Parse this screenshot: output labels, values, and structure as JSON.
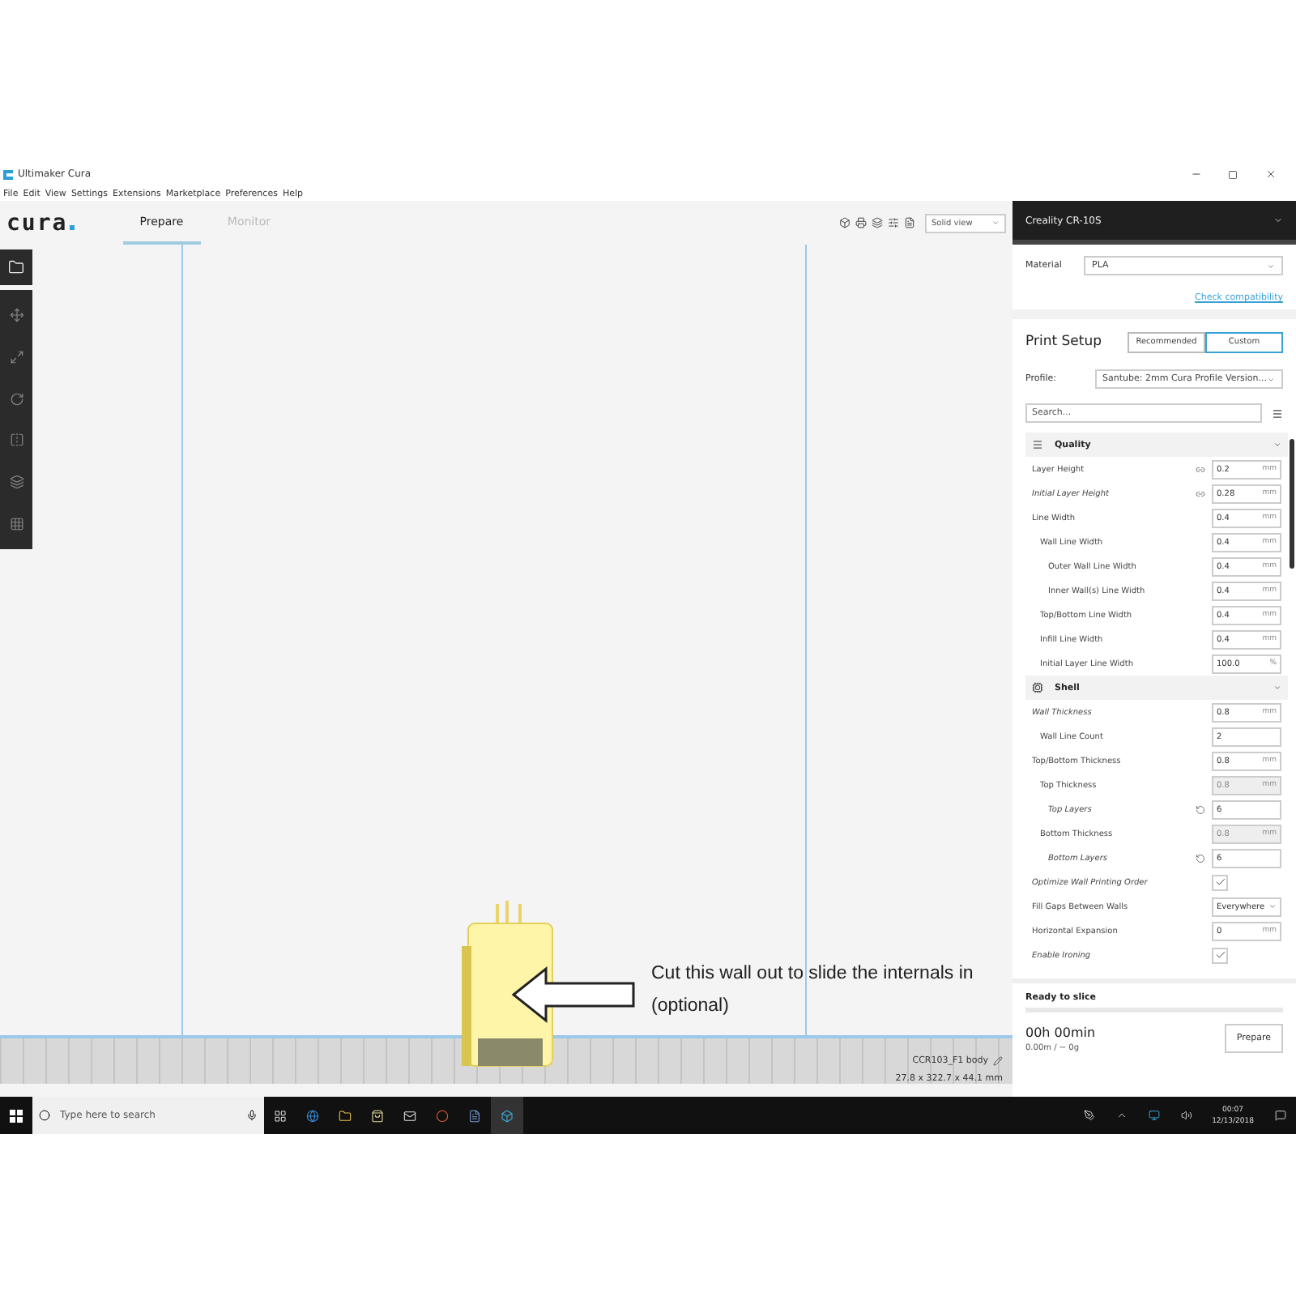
{
  "window": {
    "title": "Ultimaker Cura"
  },
  "menu": [
    "File",
    "Edit",
    "View",
    "Settings",
    "Extensions",
    "Marketplace",
    "Preferences",
    "Help"
  ],
  "header": {
    "logo": "cura",
    "tabs": [
      {
        "label": "Prepare",
        "selected": true
      },
      {
        "label": "Monitor",
        "selected": false
      }
    ],
    "view_mode": "Solid view"
  },
  "viewport": {
    "object_name": "CCR103_F1 body",
    "dimensions": "27.8 x 322.7 x 44.1 mm",
    "annotation": "Cut this wall out to slide the internals in (optional)"
  },
  "printer": {
    "name": "Creality CR-10S"
  },
  "material": {
    "label": "Material",
    "value": "PLA",
    "link": "Check compatibility"
  },
  "print_setup": {
    "title": "Print Setup",
    "modes": [
      {
        "label": "Recommended",
        "selected": false
      },
      {
        "label": "Custom",
        "selected": true
      }
    ],
    "profile_label": "Profile:",
    "profile": "Santube: 2mm Cura Profile Version...",
    "search_placeholder": "Search..."
  },
  "categories": [
    {
      "name": "Quality",
      "kind": "quality",
      "expanded": true,
      "settings": [
        {
          "label": "Layer Height",
          "kind": "number",
          "value": "0.2",
          "unit": "mm",
          "linked": true,
          "overridden": false,
          "modified": false,
          "disabled": false
        },
        {
          "label": "Initial Layer Height",
          "kind": "number",
          "value": "0.28",
          "unit": "mm",
          "linked": true,
          "overridden": false,
          "modified": true,
          "disabled": false
        },
        {
          "label": "Line Width",
          "kind": "number",
          "value": "0.4",
          "unit": "mm",
          "linked": false,
          "overridden": false,
          "modified": false,
          "disabled": false,
          "children": [
            {
              "label": "Wall Line Width",
              "kind": "number",
              "value": "0.4",
              "unit": "mm",
              "linked": false,
              "overridden": false,
              "modified": false,
              "disabled": false,
              "children": [
                {
                  "label": "Outer Wall Line Width",
                  "kind": "number",
                  "value": "0.4",
                  "unit": "mm",
                  "linked": false,
                  "overridden": false,
                  "modified": false,
                  "disabled": false
                },
                {
                  "label": "Inner Wall(s) Line Width",
                  "kind": "number",
                  "value": "0.4",
                  "unit": "mm",
                  "linked": false,
                  "overridden": false,
                  "modified": false,
                  "disabled": false
                }
              ]
            },
            {
              "label": "Top/Bottom Line Width",
              "kind": "number",
              "value": "0.4",
              "unit": "mm",
              "linked": false,
              "overridden": false,
              "modified": false,
              "disabled": false
            },
            {
              "label": "Infill Line Width",
              "kind": "number",
              "value": "0.4",
              "unit": "mm",
              "linked": false,
              "overridden": false,
              "modified": false,
              "disabled": false
            },
            {
              "label": "Initial Layer Line Width",
              "kind": "number",
              "value": "100.0",
              "unit": "%",
              "linked": false,
              "overridden": false,
              "modified": false,
              "disabled": false
            }
          ]
        }
      ]
    },
    {
      "name": "Shell",
      "kind": "shell",
      "expanded": true,
      "settings": [
        {
          "label": "Wall Thickness",
          "kind": "number",
          "value": "0.8",
          "unit": "mm",
          "linked": false,
          "overridden": false,
          "modified": true,
          "disabled": false,
          "children": [
            {
              "label": "Wall Line Count",
              "kind": "number",
              "value": "2",
              "linked": false,
              "overridden": false,
              "modified": false,
              "disabled": false
            }
          ]
        },
        {
          "label": "Top/Bottom Thickness",
          "kind": "number",
          "value": "0.8",
          "unit": "mm",
          "linked": false,
          "overridden": false,
          "modified": false,
          "disabled": false,
          "children": [
            {
              "label": "Top Thickness",
              "kind": "number",
              "value": "0.8",
              "unit": "mm",
              "linked": false,
              "overridden": false,
              "modified": false,
              "disabled": true,
              "children": [
                {
                  "label": "Top Layers",
                  "kind": "number",
                  "value": "6",
                  "linked": false,
                  "overridden": true,
                  "modified": true,
                  "disabled": false
                }
              ]
            },
            {
              "label": "Bottom Thickness",
              "kind": "number",
              "value": "0.8",
              "unit": "mm",
              "linked": false,
              "overridden": false,
              "modified": false,
              "disabled": true,
              "children": [
                {
                  "label": "Bottom Layers",
                  "kind": "number",
                  "value": "6",
                  "linked": false,
                  "overridden": true,
                  "modified": true,
                  "disabled": false
                }
              ]
            }
          ]
        },
        {
          "label": "Optimize Wall Printing Order",
          "kind": "checkbox",
          "checked": true,
          "linked": false,
          "overridden": false,
          "modified": true,
          "disabled": false
        },
        {
          "label": "Fill Gaps Between Walls",
          "kind": "select",
          "value": "Everywhere",
          "linked": false,
          "overridden": false,
          "modified": false,
          "disabled": false
        },
        {
          "label": "Horizontal Expansion",
          "kind": "number",
          "value": "0",
          "unit": "mm",
          "linked": false,
          "overridden": false,
          "modified": false,
          "disabled": false
        },
        {
          "label": "Enable Ironing",
          "kind": "checkbox",
          "checked": true,
          "linked": false,
          "overridden": false,
          "modified": true,
          "disabled": false
        }
      ]
    }
  ],
  "slice": {
    "status": "Ready to slice",
    "time": "00h 00min",
    "usage": "0.00m / ~ 0g",
    "button": "Prepare"
  },
  "taskbar": {
    "search_placeholder": "Type here to search",
    "time": "00:07",
    "date": "12/13/2018"
  }
}
